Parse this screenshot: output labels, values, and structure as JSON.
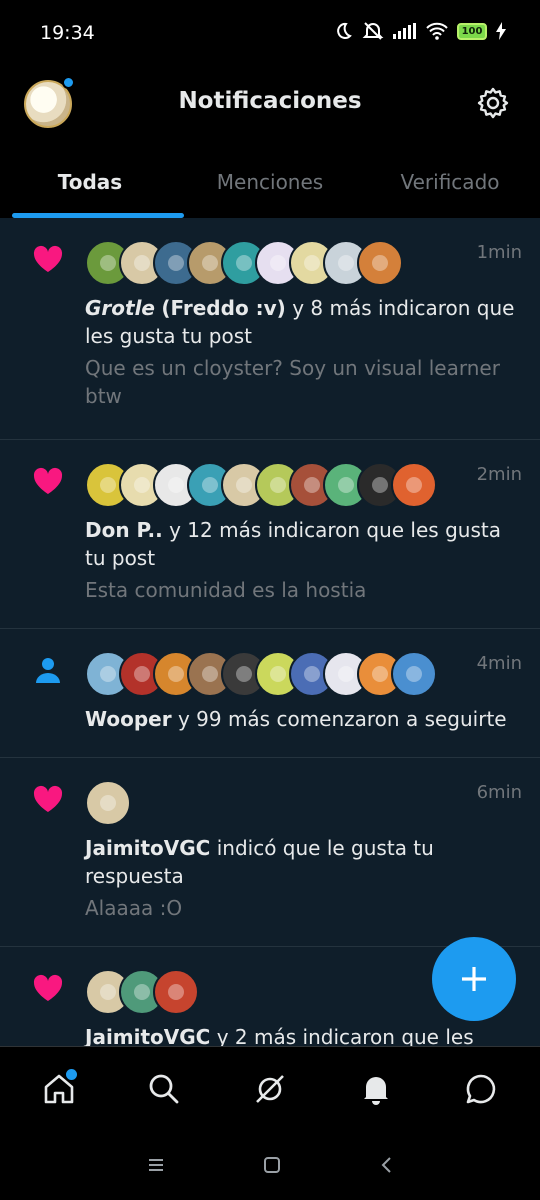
{
  "status_bar": {
    "time": "19:34",
    "battery": "100"
  },
  "header": {
    "title": "Notificaciones"
  },
  "tabs": [
    {
      "label": "Todas",
      "active": true
    },
    {
      "label": "Menciones",
      "active": false
    },
    {
      "label": "Verificado",
      "active": false
    }
  ],
  "notifications": [
    {
      "type": "like",
      "icon": "heart-icon",
      "time": "1min",
      "avatar_count": 9,
      "actor_a": "Grotle",
      "actor_b": "(Freddo :v)",
      "text": "y 8 más indicaron que les gusta tu post",
      "subtext": "Que es un cloyster? Soy un visual learner btw"
    },
    {
      "type": "like",
      "icon": "heart-icon",
      "time": "2min",
      "avatar_count": 10,
      "actor_a": "Don P..",
      "text": "y 12 más indicaron que les gusta tu post",
      "subtext": "Esta comunidad es la hostia"
    },
    {
      "type": "follow",
      "icon": "person-icon",
      "time": "4min",
      "avatar_count": 10,
      "actor_a": "Wooper",
      "text": "y 99 más comenzaron a seguirte"
    },
    {
      "type": "like",
      "icon": "heart-icon",
      "time": "6min",
      "avatar_count": 1,
      "actor_a": "JaimitoVGC",
      "text": "indicó que le gusta tu respuesta",
      "subtext": "Alaaaa :O"
    },
    {
      "type": "like",
      "icon": "heart-icon",
      "time": "",
      "avatar_count": 3,
      "actor_a": "JaimitoVGC",
      "text": "y 2 más indicaron que les"
    }
  ],
  "bottom_nav": [
    "home-icon",
    "search-icon",
    "grok-icon",
    "bell-icon",
    "messages-icon"
  ],
  "colors": {
    "accent": "#1d9bf0",
    "like": "#f91880",
    "feed_bg": "#0f1e2a"
  }
}
